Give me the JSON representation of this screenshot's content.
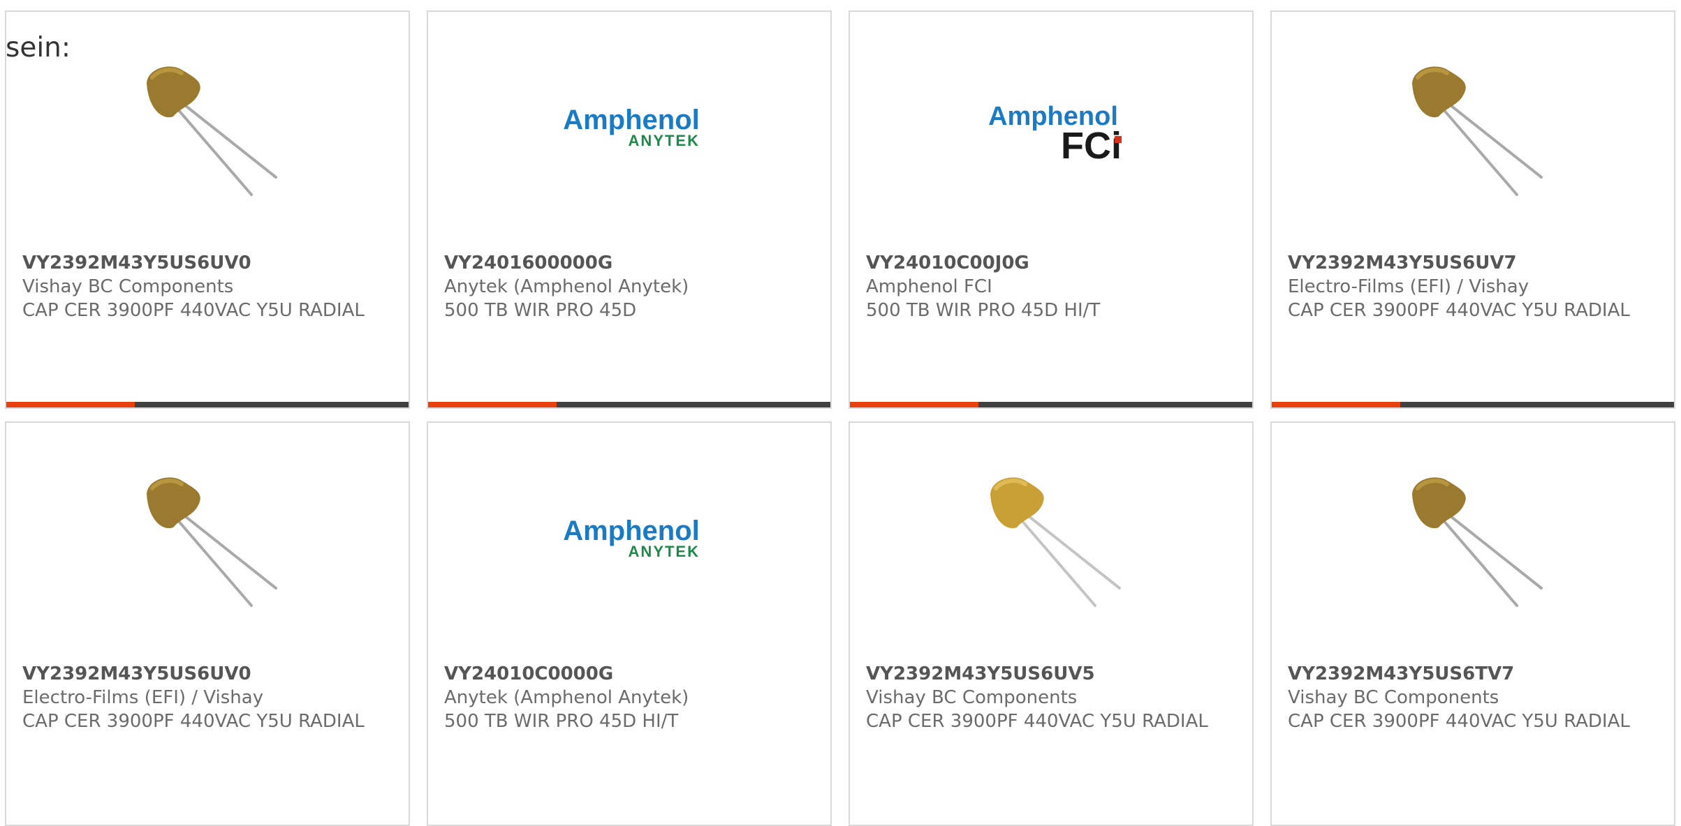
{
  "intro_text": "sein:",
  "accent_color": "#e8400d",
  "bar_track_color": "#404040",
  "products": [
    {
      "part_number": "VY2392M43Y5US6UV0",
      "manufacturer": "Vishay BC Components",
      "description": "CAP CER 3900PF 440VAC Y5U RADIAL",
      "image": "ceramic-capacitor-image",
      "progress_fraction": 0.32
    },
    {
      "part_number": "VY2401600000G",
      "manufacturer": "Anytek (Amphenol Anytek)",
      "description": "500 TB WIR PRO 45D",
      "image": "amphenol-anytek-logo",
      "logo_text": "Amphenol",
      "logo_subtext": "ANYTEK",
      "progress_fraction": 0.32
    },
    {
      "part_number": "VY24010C00J0G",
      "manufacturer": "Amphenol FCI",
      "description": "500 TB WIR PRO 45D HI/T",
      "image": "amphenol-fci-logo",
      "logo_text": "Amphenol",
      "logo_subtext": "FCi",
      "progress_fraction": 0.32
    },
    {
      "part_number": "VY2392M43Y5US6UV7",
      "manufacturer": "Electro-Films (EFI) / Vishay",
      "description": "CAP CER 3900PF 440VAC Y5U RADIAL",
      "image": "ceramic-capacitor-image",
      "progress_fraction": 0.32
    },
    {
      "part_number": "VY2392M43Y5US6UV0",
      "manufacturer": "Electro-Films (EFI) / Vishay",
      "description": "CAP CER 3900PF 440VAC Y5U RADIAL",
      "image": "ceramic-capacitor-image"
    },
    {
      "part_number": "VY24010C0000G",
      "manufacturer": "Anytek (Amphenol Anytek)",
      "description": "500 TB WIR PRO 45D HI/T",
      "image": "amphenol-anytek-logo",
      "logo_text": "Amphenol",
      "logo_subtext": "ANYTEK"
    },
    {
      "part_number": "VY2392M43Y5US6UV5",
      "manufacturer": "Vishay BC Components",
      "description": "CAP CER 3900PF 440VAC Y5U RADIAL",
      "image": "ceramic-capacitor-image"
    },
    {
      "part_number": "VY2392M43Y5US6TV7",
      "manufacturer": "Vishay BC Components",
      "description": "CAP CER 3900PF 440VAC Y5U RADIAL",
      "image": "ceramic-capacitor-image"
    }
  ]
}
